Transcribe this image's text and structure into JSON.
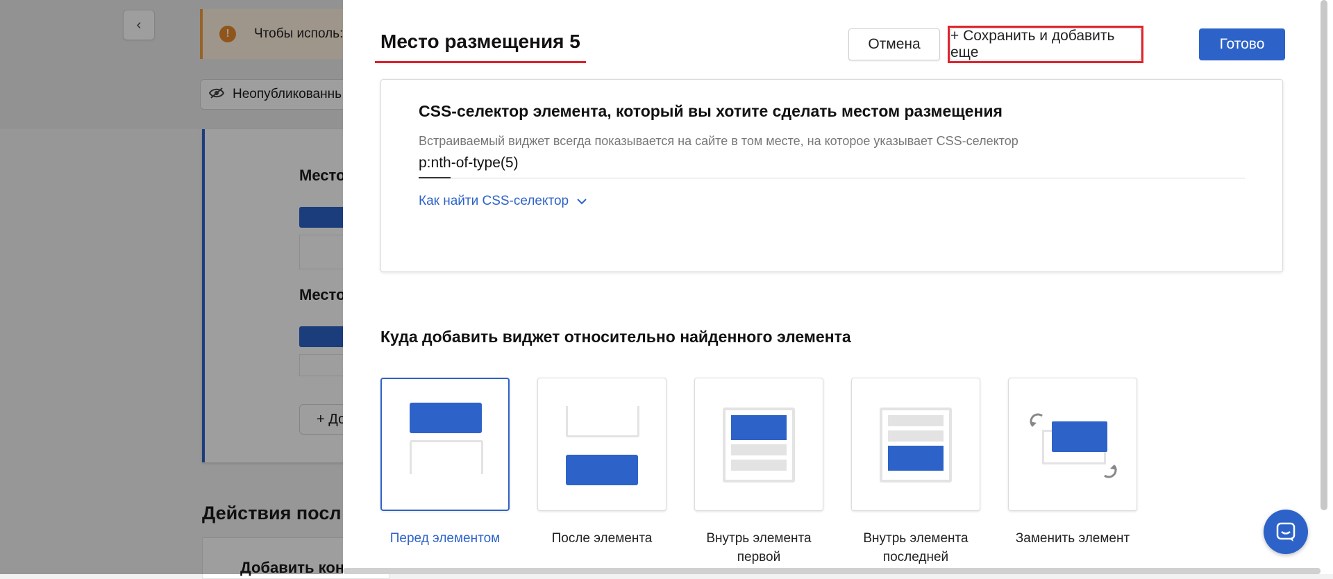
{
  "background": {
    "warning_text": "Чтобы исполь:",
    "unpublished_label": "Неопубликованнь",
    "place_label_1": "Место",
    "place_label_2": "Место",
    "add_label": "+ До",
    "actions_title": "Действия посл",
    "add_content_label": "Добавить кон"
  },
  "modal": {
    "title": "Место размещения 5",
    "cancel_label": "Отмена",
    "save_add_label": "+ Сохранить и добавить еще",
    "done_label": "Готово",
    "css_section": {
      "title": "CSS-селектор элемента, который вы хотите сделать местом размещения",
      "description": "Встраиваемый виджет всегда показывается на сайте в том месте, на которое указывает CSS-селектор",
      "selector_value": "p:nth-of-type(5)",
      "how_to_find_label": "Как найти CSS-селектор"
    },
    "where_title": "Куда добавить виджет относительно найденного элемента",
    "options": [
      {
        "label": "Перед элементом",
        "selected": true
      },
      {
        "label": "После элемента",
        "selected": false
      },
      {
        "label": "Внутрь элемента первой",
        "selected": false
      },
      {
        "label": "Внутрь элемента последней",
        "selected": false
      },
      {
        "label": "Заменить элемент",
        "selected": false
      }
    ]
  },
  "colors": {
    "accent": "#2d63c8",
    "highlight": "#e0242c",
    "warning": "#e8892b"
  }
}
